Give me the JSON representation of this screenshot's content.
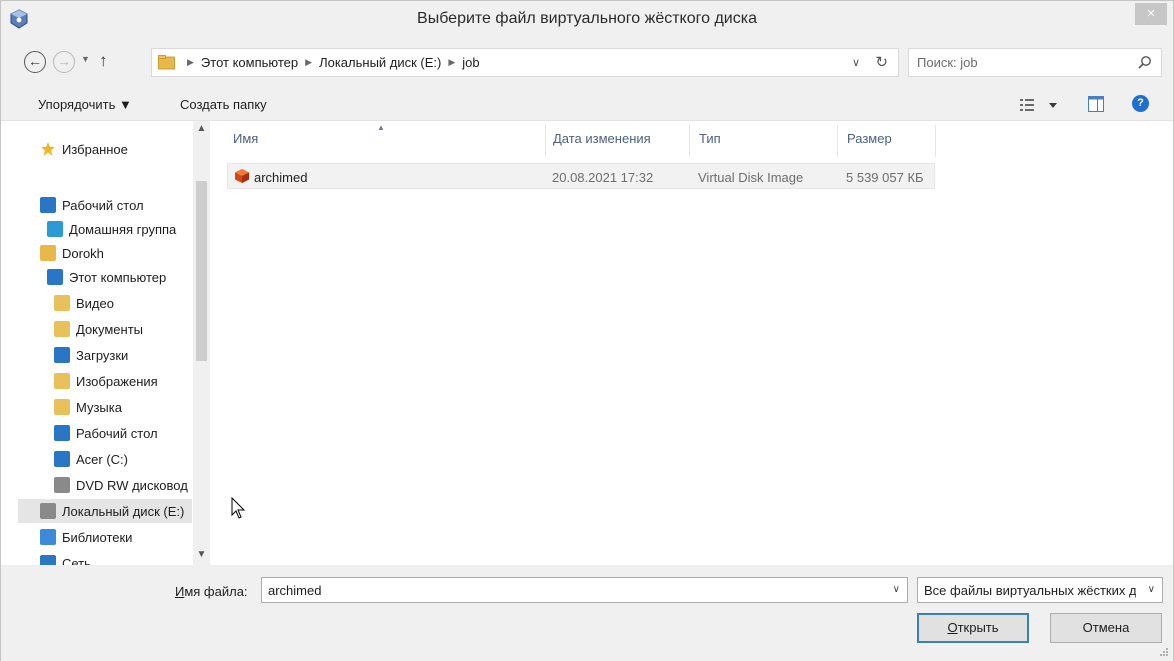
{
  "window": {
    "title": "Выберите файл виртуального жёсткого диска",
    "close_glyph": "×"
  },
  "address": {
    "breadcrumbs": [
      "Этот компьютер",
      "Локальный диск (E:)",
      "job"
    ],
    "search_placeholder": "Поиск: job"
  },
  "toolbar": {
    "organize_label": "Упорядочить ▼",
    "new_folder_label": "Создать папку",
    "help_glyph": "?"
  },
  "nav": {
    "items": [
      {
        "label": "Избранное",
        "icon": "star-icon",
        "color": "#f2b624"
      },
      {
        "label": "Рабочий стол",
        "icon": "desktop-icon",
        "color": "#2a76c6"
      },
      {
        "label": "Домашняя группа",
        "icon": "homegroup-icon",
        "color": "#2c9ad3"
      },
      {
        "label": "Dorokh",
        "icon": "user-folder-icon",
        "color": "#e8b84a"
      },
      {
        "label": "Этот компьютер",
        "icon": "computer-icon",
        "color": "#2a76c6"
      },
      {
        "label": "Видео",
        "icon": "video-folder-icon",
        "color": "#e8c15a"
      },
      {
        "label": "Документы",
        "icon": "documents-folder-icon",
        "color": "#e8c15a"
      },
      {
        "label": "Загрузки",
        "icon": "downloads-folder-icon",
        "color": "#2a76c6"
      },
      {
        "label": "Изображения",
        "icon": "pictures-folder-icon",
        "color": "#e8c15a"
      },
      {
        "label": "Музыка",
        "icon": "music-folder-icon",
        "color": "#e8c15a"
      },
      {
        "label": "Рабочий стол",
        "icon": "desktop-folder-icon",
        "color": "#2a76c6"
      },
      {
        "label": "Acer (C:)",
        "icon": "system-drive-icon",
        "color": "#2a76c6"
      },
      {
        "label": "DVD RW дисковод",
        "icon": "dvd-drive-icon",
        "color": "#8a8a8a"
      },
      {
        "label": "Локальный диск (E:)",
        "icon": "local-drive-icon",
        "color": "#8a8a8a"
      },
      {
        "label": "Библиотеки",
        "icon": "libraries-icon",
        "color": "#3c8ad8"
      },
      {
        "label": "Сеть",
        "icon": "network-icon",
        "color": "#2a76c6"
      }
    ],
    "selected_index": 13
  },
  "list": {
    "columns": [
      "Имя",
      "Дата изменения",
      "Тип",
      "Размер"
    ],
    "rows": [
      {
        "name": "archimed",
        "date": "20.08.2021 17:32",
        "type": "Virtual Disk Image",
        "size": "5 539 057 КБ"
      }
    ]
  },
  "bottom": {
    "filename_label_accel": "И",
    "filename_label_rest": "мя файла:",
    "filename_value": "archimed",
    "filetype_value": "Все файлы виртуальных жёстких дисков",
    "open_accel": "О",
    "open_rest": "ткрыть",
    "cancel_label": "Отмена"
  }
}
